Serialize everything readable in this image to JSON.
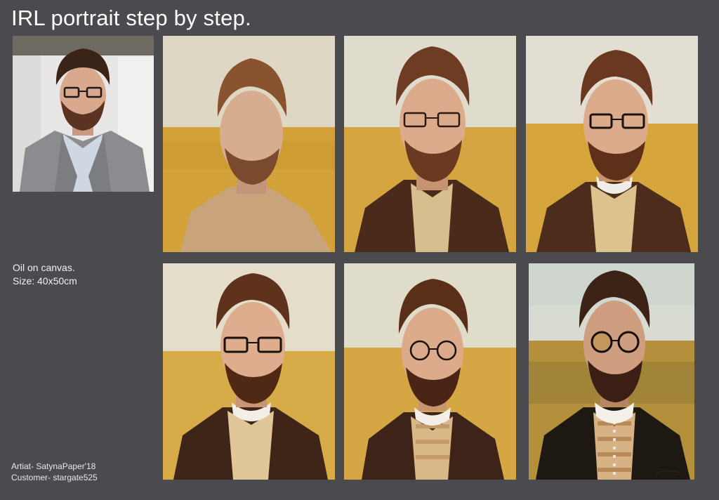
{
  "title": "IRL portrait step by step.",
  "info": {
    "medium": "Oil on canvas.",
    "size": "Size: 40x50cm"
  },
  "credits": {
    "artist": "Artiat- SatynaPaper'18",
    "customer": "Customer- stargate525"
  },
  "colors": {
    "background": "#4a4a4f",
    "text": "#ffffff",
    "field_yellow": "#d2a236",
    "sky": "#dcdccf",
    "hair": "#6b3a1e",
    "beard": "#5a2e18"
  }
}
